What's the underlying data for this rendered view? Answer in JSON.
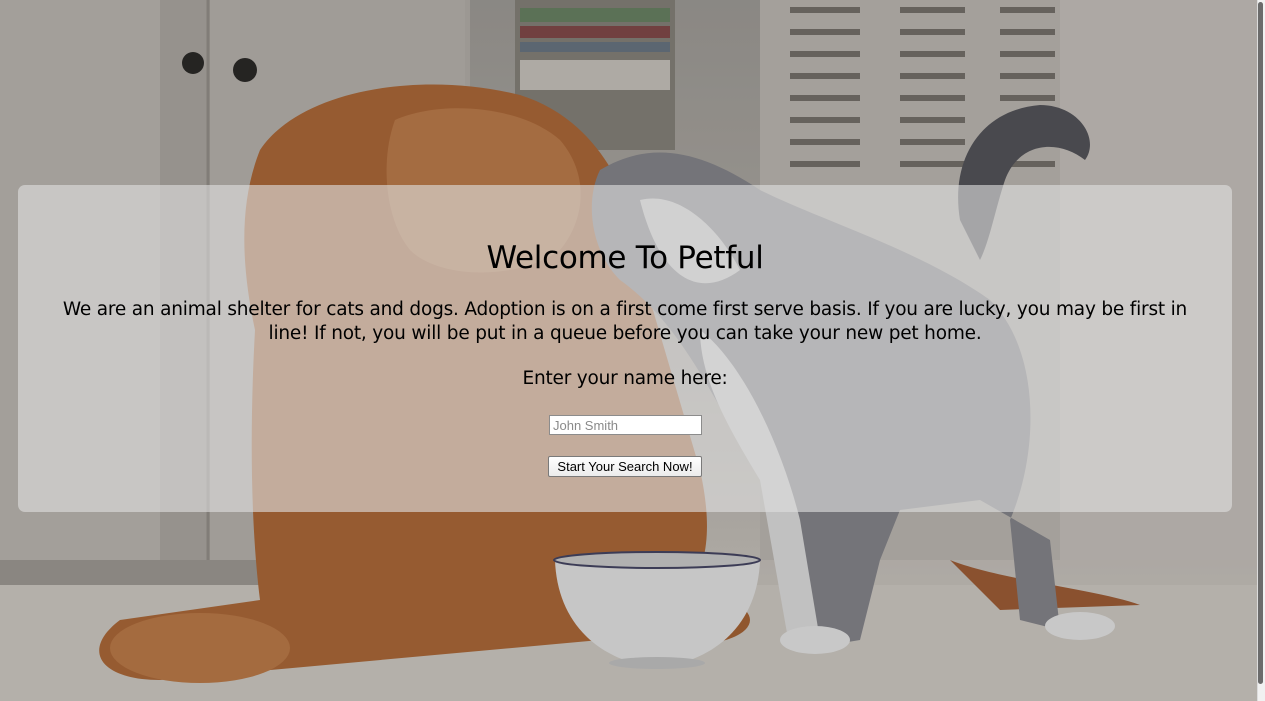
{
  "welcome": {
    "title": "Welcome To Petful",
    "description": "We are an animal shelter for cats and dogs. Adoption is on a first come first serve basis. If you are lucky, you may be first in line! If not, you will be put in a queue before you can take your new pet home.",
    "name_prompt": "Enter your name here:",
    "name_input": {
      "value": "",
      "placeholder": "John Smith"
    },
    "search_button_label": "Start Your Search Now!"
  },
  "colors": {
    "panel_overlay": "#dedede",
    "text": "#000000",
    "dog_fur": "#b86f3c",
    "cat_fur": "#8e8e94",
    "floor": "#e2ddd6"
  },
  "background_image": {
    "subject": "golden-retriever-and-gray-white-cat-with-food-bowl"
  }
}
